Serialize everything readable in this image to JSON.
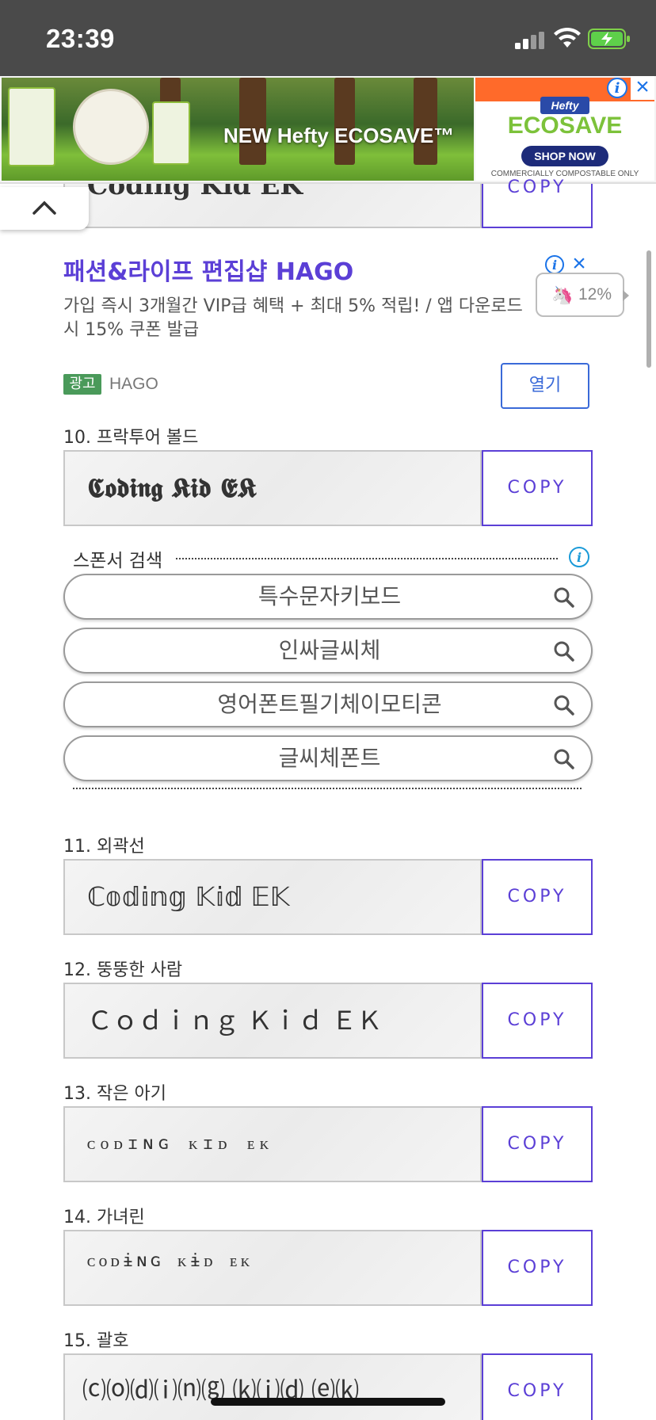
{
  "status_bar": {
    "time": "23:39"
  },
  "top_ad": {
    "headline": "NEW Hefty ECOSAVE™",
    "brand": "Hefty",
    "product": "ECOSAVE",
    "cta": "SHOP NOW",
    "tagline": "COMMERCIALLY COMPOSTABLE ONLY",
    "info_icon": "info-icon",
    "close_icon": "close-icon"
  },
  "native_ad": {
    "title": "패션&라이프 편집샵 HAGO",
    "description": "가입 즉시 3개월간 VIP급 혜택 + 최대 5% 적립! / 앱 다운로드 시 15% 쿠폰 발급",
    "badge": "광고",
    "brand": "HAGO",
    "open_label": "열기",
    "progress_label": "12%"
  },
  "partial_row": {
    "sample": "Coding Kid EK",
    "copy_label": "COPY"
  },
  "rows": [
    {
      "label": "10. 프락투어 볼드",
      "sample": "𝕮𝖔𝖉𝖎𝖓𝖌 𝕶𝖎𝖉 𝕰𝕶",
      "copy_label": "COPY"
    },
    {
      "label": "11. 외곽선",
      "sample": "ℂ𝕠𝕕𝕚𝕟𝕘 𝕂𝕚𝕕 𝔼𝕂",
      "copy_label": "COPY"
    },
    {
      "label": "12. 뚱뚱한 사람",
      "sample": "Ｃｏｄｉｎｇ Ｋｉｄ ＥＫ",
      "copy_label": "COPY"
    },
    {
      "label": "13. 작은 아기",
      "sample": "ᴄᴏᴅɪɴɢ ᴋɪᴅ ᴇᴋ",
      "copy_label": "COPY"
    },
    {
      "label": "14. 가녀린",
      "sample": "ᴄᴏᴅɨɴɢ ᴋɨᴅ ᴇᴋ",
      "copy_label": "COPY"
    },
    {
      "label": "15. 괄호",
      "sample": "⒞⒪⒟⒤⒩⒢ ⒦⒤⒟ ⒠⒦",
      "copy_label": "COPY"
    }
  ],
  "sponsor_search": {
    "title": "스폰서 검색",
    "queries": [
      "특수문자키보드",
      "인싸글씨체",
      "영어폰트필기체이모티콘",
      "글씨체폰트"
    ]
  },
  "colors": {
    "accent": "#5b3fd6",
    "link": "#1a73e8",
    "status_bg": "#4a4a4a"
  }
}
